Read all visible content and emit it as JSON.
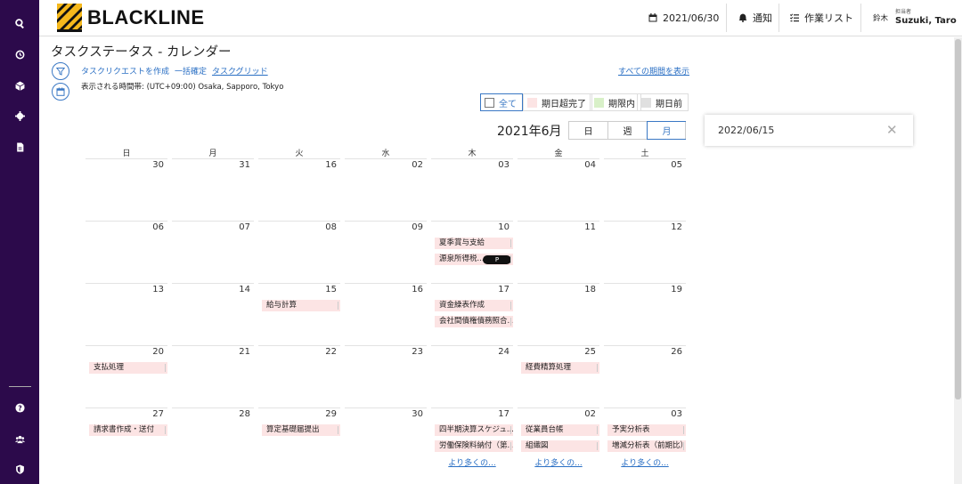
{
  "sidebar": {
    "icons": [
      "search-icon",
      "history-icon",
      "cube-icon",
      "gear-icon",
      "document-icon",
      "help-icon",
      "users-icon",
      "shield-icon"
    ]
  },
  "header": {
    "logo": "BLACKLINE",
    "date": "2021/06/30",
    "notifications": "通知",
    "worklist": "作業リスト",
    "user_short": "鈴木",
    "user_role": "担当者",
    "user_name": "Suzuki, Taro"
  },
  "page": {
    "title": "タスクステータス - カレンダー",
    "link_create": "タスクリクエストを作成",
    "link_bulk": "一括確定",
    "link_grid": "タスクグリッド",
    "timezone": "表示される時間帯: (UTC+09:00) Osaka, Sapporo, Tokyo",
    "show_all": "すべての期間を表示"
  },
  "legend": {
    "all": "全て",
    "overdue_done": "期日超完了",
    "within": "期限内",
    "before": "期日前",
    "colors": {
      "overdue_done": "#fce4e4",
      "within": "#d8f0c8",
      "before": "#e0e0e0"
    }
  },
  "calendar": {
    "month_label": "2021年6月",
    "views": [
      "日",
      "週",
      "月"
    ],
    "active_view": "月",
    "weekdays": [
      "日",
      "月",
      "火",
      "水",
      "木",
      "金",
      "土"
    ],
    "weeks": [
      [
        {
          "d": "30",
          "ev": []
        },
        {
          "d": "31",
          "ev": []
        },
        {
          "d": "16",
          "ev": []
        },
        {
          "d": "02",
          "ev": []
        },
        {
          "d": "03",
          "ev": []
        },
        {
          "d": "04",
          "ev": []
        },
        {
          "d": "05",
          "ev": []
        }
      ],
      [
        {
          "d": "06",
          "ev": []
        },
        {
          "d": "07",
          "ev": []
        },
        {
          "d": "08",
          "ev": []
        },
        {
          "d": "09",
          "ev": []
        },
        {
          "d": "10",
          "ev": [
            "夏季賞与支給",
            "源泉所得税..."
          ],
          "pill": "P"
        },
        {
          "d": "11",
          "ev": []
        },
        {
          "d": "12",
          "ev": []
        }
      ],
      [
        {
          "d": "13",
          "ev": []
        },
        {
          "d": "14",
          "ev": []
        },
        {
          "d": "15",
          "ev": [
            "給与計算"
          ]
        },
        {
          "d": "16",
          "ev": []
        },
        {
          "d": "17",
          "ev": [
            "資金繰表作成",
            "会社間債権債務照合..."
          ]
        },
        {
          "d": "18",
          "ev": []
        },
        {
          "d": "19",
          "ev": []
        }
      ],
      [
        {
          "d": "20",
          "ev": [
            "支払処理"
          ]
        },
        {
          "d": "21",
          "ev": []
        },
        {
          "d": "22",
          "ev": []
        },
        {
          "d": "23",
          "ev": []
        },
        {
          "d": "24",
          "ev": []
        },
        {
          "d": "25",
          "ev": [
            "経費精算処理"
          ]
        },
        {
          "d": "26",
          "ev": []
        }
      ],
      [
        {
          "d": "27",
          "ev": [
            "請求書作成・送付"
          ]
        },
        {
          "d": "28",
          "ev": []
        },
        {
          "d": "29",
          "ev": [
            "算定基礎届提出"
          ]
        },
        {
          "d": "30",
          "ev": []
        },
        {
          "d": "17",
          "ev": [
            "四半期決算スケジュ...",
            "労働保険料納付（第..."
          ],
          "more": "より多くの..."
        },
        {
          "d": "02",
          "ev": [
            "従業員台帳",
            "組織図"
          ],
          "more": "より多くの..."
        },
        {
          "d": "03",
          "ev": [
            "予実分析表",
            "増減分析表（前期比）"
          ],
          "more": "より多くの..."
        }
      ]
    ]
  },
  "side_panel": {
    "date": "2022/06/15"
  }
}
